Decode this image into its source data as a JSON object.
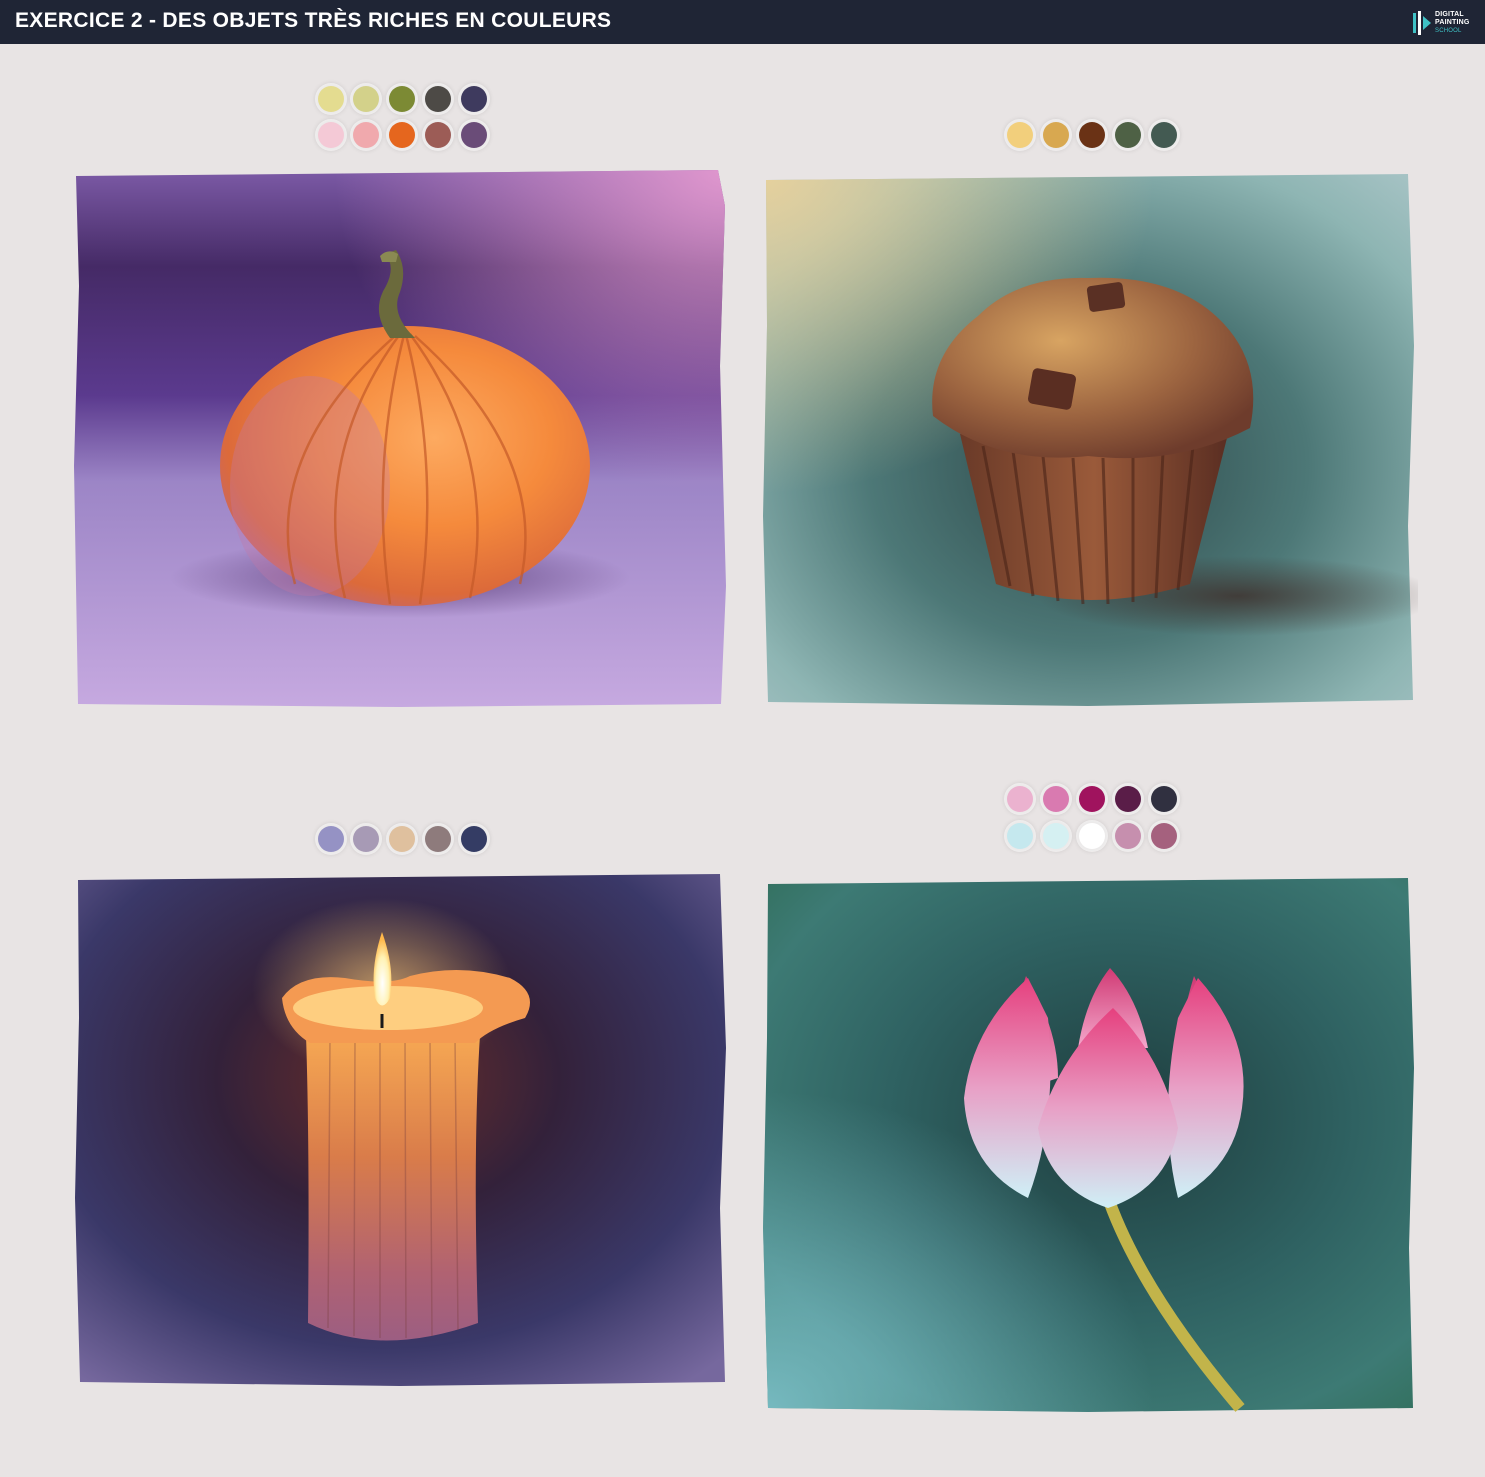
{
  "header": {
    "title": "EXERCICE 2 - DES OBJETS TRÈS RICHES EN COULEURS",
    "logo_lines": [
      "DIGITAL",
      "PAINTING",
      "SCHOOL"
    ]
  },
  "paintings": [
    {
      "subject": "pumpkin",
      "palette": [
        [
          "#e4dc90",
          "#d3d18a",
          "#7c8a34",
          "#4d4a46",
          "#3e3a5e"
        ],
        [
          "#f4c9d6",
          "#f0a9ad",
          "#e5661e",
          "#9c5c56",
          "#6a4c78"
        ]
      ]
    },
    {
      "subject": "muffin",
      "palette": [
        [
          "#f2cf7c",
          "#d8a850",
          "#6a3215",
          "#4e6145",
          "#435a52"
        ]
      ]
    },
    {
      "subject": "candle",
      "palette": [
        [
          "#9592c4",
          "#a79ab5",
          "#dfc09e",
          "#8e7b7c",
          "#343c64"
        ]
      ]
    },
    {
      "subject": "lotus-flower",
      "palette": [
        [
          "#ebb2cf",
          "#d97ab0",
          "#a0135e",
          "#5a1d48",
          "#303040"
        ],
        [
          "#c5e8ee",
          "#d5f0f2",
          "#ffffff",
          "#c68fae",
          "#a5617e"
        ]
      ]
    }
  ]
}
